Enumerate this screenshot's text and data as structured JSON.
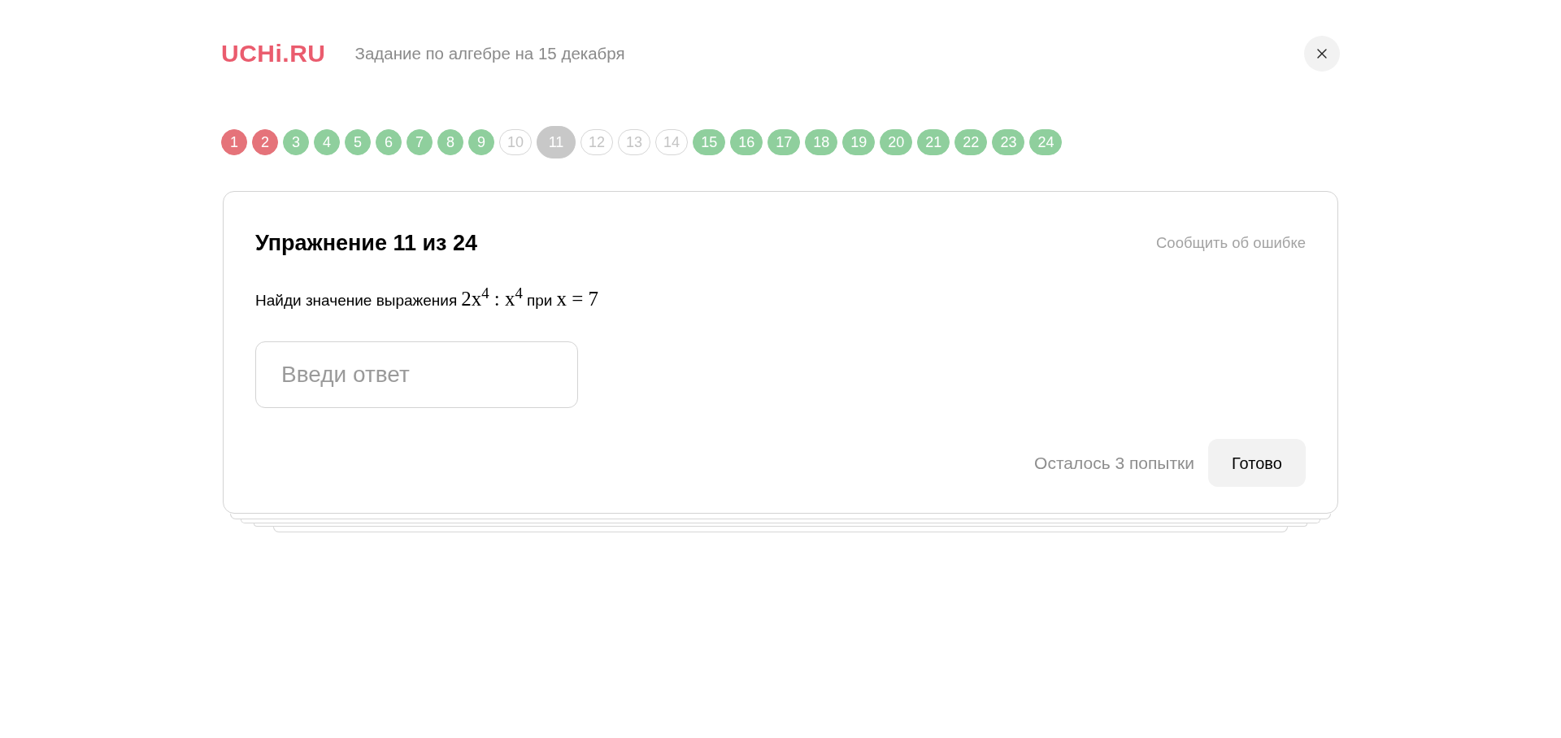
{
  "header": {
    "logo": "UCHi.RU",
    "title": "Задание по алгебре на 15 декабря"
  },
  "progress": [
    {
      "label": "1",
      "kind": "wrong",
      "selected": false
    },
    {
      "label": "2",
      "kind": "wrong",
      "selected": false
    },
    {
      "label": "3",
      "kind": "correct",
      "selected": false
    },
    {
      "label": "4",
      "kind": "correct",
      "selected": false
    },
    {
      "label": "5",
      "kind": "correct",
      "selected": false
    },
    {
      "label": "6",
      "kind": "correct",
      "selected": false
    },
    {
      "label": "7",
      "kind": "correct",
      "selected": false
    },
    {
      "label": "8",
      "kind": "correct",
      "selected": false
    },
    {
      "label": "9",
      "kind": "correct",
      "selected": false
    },
    {
      "label": "10",
      "kind": "unanswered",
      "selected": false
    },
    {
      "label": "11",
      "kind": "unanswered",
      "selected": true
    },
    {
      "label": "12",
      "kind": "unanswered",
      "selected": false
    },
    {
      "label": "13",
      "kind": "unanswered",
      "selected": false
    },
    {
      "label": "14",
      "kind": "unanswered",
      "selected": false
    },
    {
      "label": "15",
      "kind": "correct",
      "selected": false
    },
    {
      "label": "16",
      "kind": "correct",
      "selected": false
    },
    {
      "label": "17",
      "kind": "correct",
      "selected": false
    },
    {
      "label": "18",
      "kind": "correct",
      "selected": false
    },
    {
      "label": "19",
      "kind": "correct",
      "selected": false
    },
    {
      "label": "20",
      "kind": "correct",
      "selected": false
    },
    {
      "label": "21",
      "kind": "correct",
      "selected": false
    },
    {
      "label": "22",
      "kind": "correct",
      "selected": false
    },
    {
      "label": "23",
      "kind": "correct",
      "selected": false
    },
    {
      "label": "24",
      "kind": "correct",
      "selected": false
    }
  ],
  "exercise": {
    "heading": "Упражнение 11 из 24",
    "report_link": "Сообщить об ошибке",
    "question": [
      {
        "kind": "text",
        "text": "Найди значение выражения"
      },
      {
        "kind": "math",
        "text": "2x$^{4}$ : x$^{4}$"
      },
      {
        "kind": "text",
        "text": "при"
      },
      {
        "kind": "math",
        "text": "x = 7"
      }
    ],
    "answer": {
      "placeholder": "Введи ответ"
    },
    "attempts": "Осталось 3 попытки",
    "submit": "Готово"
  }
}
